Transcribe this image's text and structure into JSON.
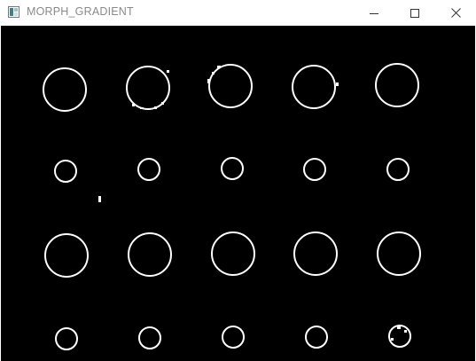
{
  "window": {
    "title": "MORPH_GRADIENT",
    "icon": "opencv-window-icon",
    "controls": [
      "minimize-icon",
      "maximize-icon",
      "close-icon"
    ]
  },
  "colors": {
    "titlebar_bg": "#ffffff",
    "title_text": "#8a8a8a",
    "canvas_bg": "#000000",
    "stroke": "#ffffff"
  }
}
